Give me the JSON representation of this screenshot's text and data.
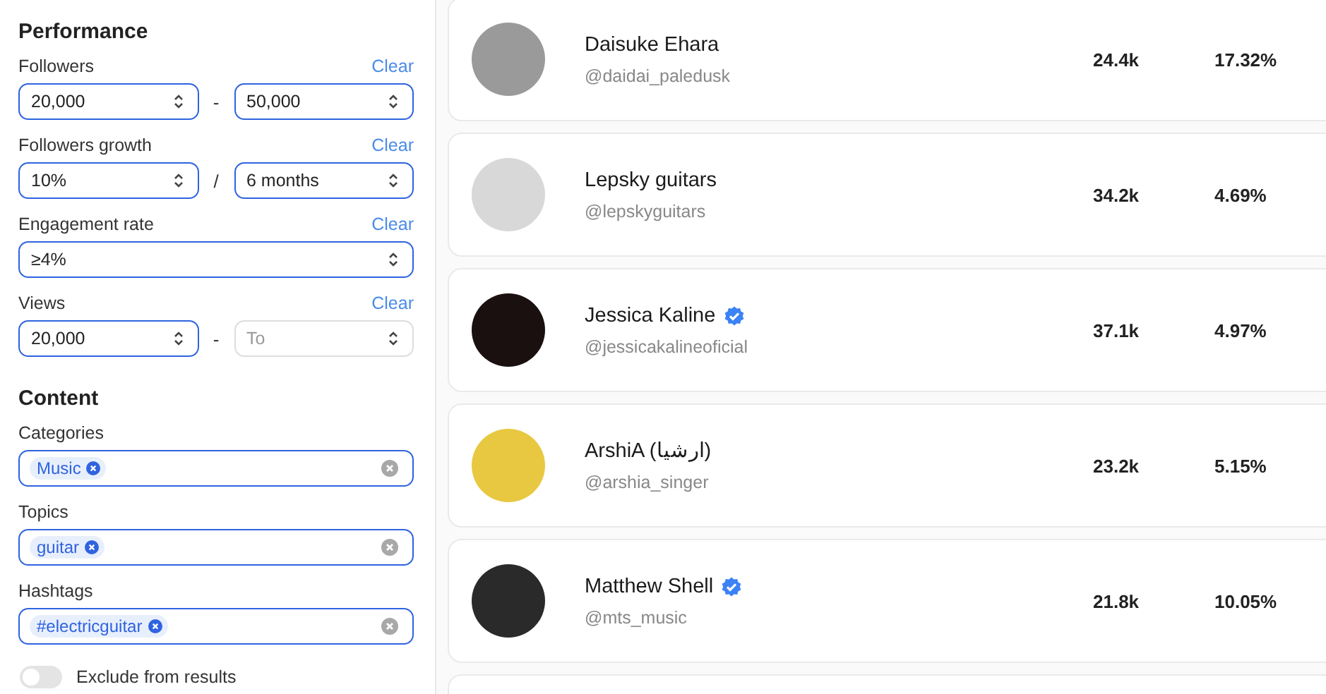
{
  "filters": [
    {
      "title": "Performance",
      "groups": [
        {
          "label": "Followers",
          "clear": "Clear",
          "separator": "-",
          "inputs": [
            {
              "value": "20,000"
            },
            {
              "value": "50,000"
            }
          ]
        },
        {
          "label": "Followers growth",
          "clear": "Clear",
          "separator": "/",
          "inputs": [
            {
              "value": "10%"
            },
            {
              "value": "6 months"
            }
          ]
        },
        {
          "label": "Engagement rate",
          "clear": "Clear",
          "inputs": [
            {
              "value": "≥4%"
            }
          ]
        },
        {
          "label": "Views",
          "clear": "Clear",
          "separator": "-",
          "inputs": [
            {
              "value": "20,000"
            },
            {
              "placeholder": "To"
            }
          ]
        }
      ]
    },
    {
      "title": "Content",
      "groups": [
        {
          "label": "Categories",
          "chips": [
            "Music"
          ]
        },
        {
          "label": "Topics",
          "chips": [
            "guitar"
          ]
        },
        {
          "label": "Hashtags",
          "chips": [
            "#electricguitar"
          ]
        }
      ]
    }
  ],
  "exclude_toggle": {
    "label": "Exclude from results",
    "on": false
  },
  "creators": [
    {
      "name": "Daisuke Ehara",
      "handle": "@daidai_paledusk",
      "verified": false,
      "followers": "24.4k",
      "engagement": "17.32%"
    },
    {
      "name": "Lepsky guitars",
      "handle": "@lepskyguitars",
      "verified": false,
      "followers": "34.2k",
      "engagement": "4.69%"
    },
    {
      "name": "Jessica Kaline",
      "handle": "@jessicakalineoficial",
      "verified": true,
      "followers": "37.1k",
      "engagement": "4.97%"
    },
    {
      "name": "ArshiA (ارشیا)",
      "handle": "@arshia_singer",
      "verified": false,
      "followers": "23.2k",
      "engagement": "5.15%"
    },
    {
      "name": "Matthew Shell",
      "handle": "@mts_music",
      "verified": true,
      "followers": "21.8k",
      "engagement": "10.05%"
    }
  ]
}
